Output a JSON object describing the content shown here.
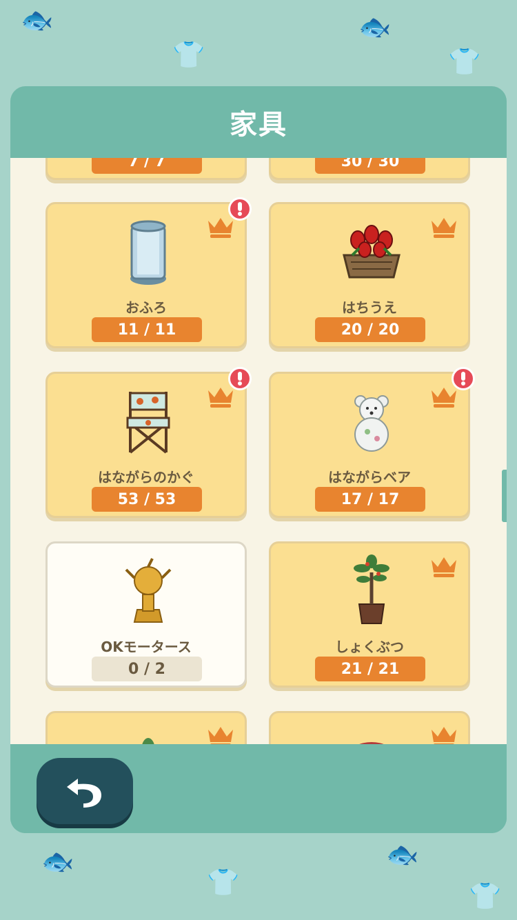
{
  "panel": {
    "title": "家具"
  },
  "cards_top_partial": [
    {
      "count": "7 / 7"
    },
    {
      "count": "30 / 30"
    }
  ],
  "cards": [
    {
      "name": "おふろ",
      "count": "11 / 11",
      "complete": true,
      "alert": true,
      "icon": "bathtub-icon"
    },
    {
      "name": "はちうえ",
      "count": "20 / 20",
      "complete": true,
      "alert": false,
      "icon": "flowerpot-icon"
    },
    {
      "name": "はながらのかぐ",
      "count": "53 / 53",
      "complete": true,
      "alert": true,
      "icon": "chair-icon"
    },
    {
      "name": "はながらベア",
      "count": "17 / 17",
      "complete": true,
      "alert": true,
      "icon": "bear-icon"
    },
    {
      "name": "OKモータース",
      "count": "0 / 2",
      "complete": false,
      "alert": false,
      "icon": "trophy-icon"
    },
    {
      "name": "しょくぶつ",
      "count": "21 / 21",
      "complete": true,
      "alert": false,
      "icon": "plant-icon"
    }
  ],
  "colors": {
    "complete_bg": "#fbdf91",
    "count_badge": "#e8842f",
    "crown": "#e8842f",
    "alert": "#e64a57",
    "header": "#71b9a9"
  },
  "footer": {
    "back_icon": "back-arrow-icon"
  }
}
